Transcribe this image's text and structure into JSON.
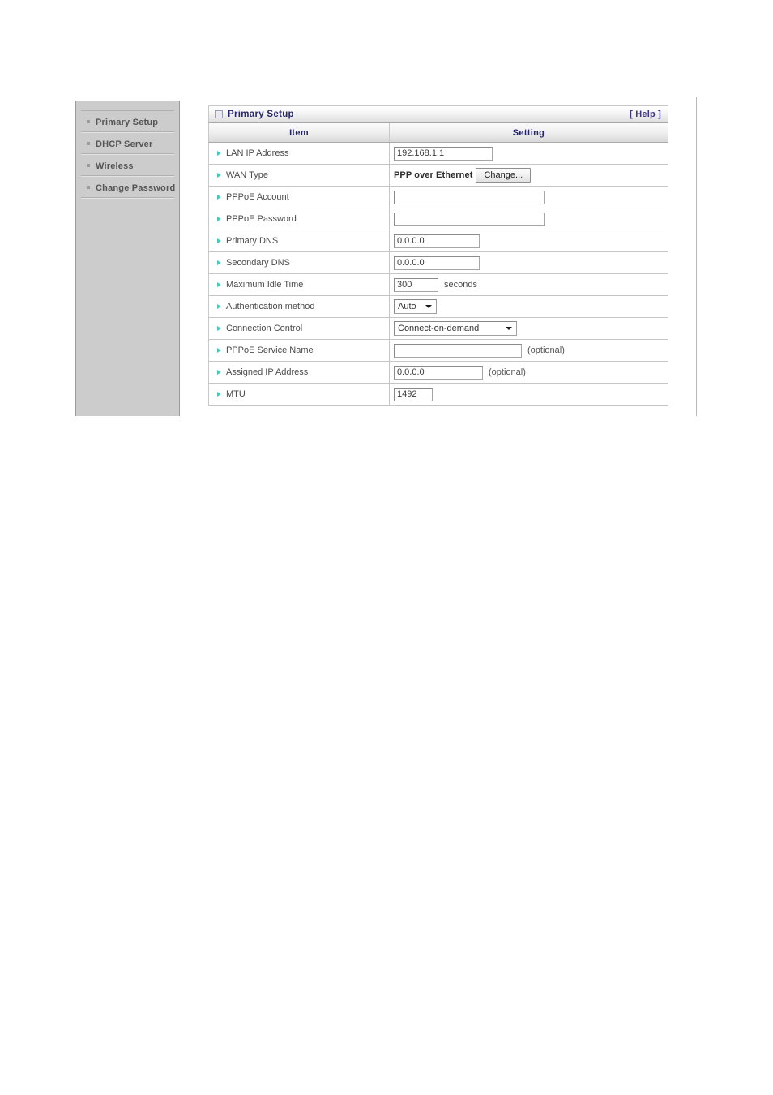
{
  "sidebar": {
    "items": [
      {
        "label": "Primary Setup",
        "name": "sidebar-item-primary-setup"
      },
      {
        "label": "DHCP Server",
        "name": "sidebar-item-dhcp-server"
      },
      {
        "label": "Wireless",
        "name": "sidebar-item-wireless"
      },
      {
        "label": "Change Password",
        "name": "sidebar-item-change-password"
      }
    ]
  },
  "panel": {
    "title": "Primary Setup",
    "title_icon": "window-box-icon",
    "help_label": "[ Help ]",
    "columns": {
      "item": "Item",
      "setting": "Setting"
    },
    "rows": {
      "lan_ip": {
        "label": "LAN IP Address",
        "value": "192.168.1.1"
      },
      "wan_type": {
        "label": "WAN Type",
        "value": "PPP over Ethernet",
        "button": "Change..."
      },
      "pppoe_account": {
        "label": "PPPoE Account",
        "value": "",
        "placeholder": ""
      },
      "pppoe_password": {
        "label": "PPPoE Password",
        "value": "",
        "placeholder": ""
      },
      "primary_dns": {
        "label": "Primary DNS",
        "value": "0.0.0.0"
      },
      "secondary_dns": {
        "label": "Secondary DNS",
        "value": "0.0.0.0"
      },
      "max_idle": {
        "label": "Maximum Idle Time",
        "value": "300",
        "suffix": "seconds"
      },
      "auth_method": {
        "label": "Authentication method",
        "value": "Auto",
        "options": [
          "Auto"
        ]
      },
      "connection_control": {
        "label": "Connection Control",
        "value": "Connect-on-demand",
        "options": [
          "Connect-on-demand"
        ]
      },
      "pppoe_service_name": {
        "label": "PPPoE Service Name",
        "value": "",
        "suffix": "(optional)"
      },
      "assigned_ip": {
        "label": "Assigned IP Address",
        "value": "0.0.0.0",
        "suffix": "(optional)"
      },
      "mtu": {
        "label": "MTU",
        "value": "1492"
      }
    }
  },
  "colors": {
    "title_text": "#26256b",
    "help_text": "#3b357f",
    "bullet_triangle": "#45c8c0",
    "sidebar_bg": "#cccccc",
    "sidebar_text": "#555555"
  }
}
